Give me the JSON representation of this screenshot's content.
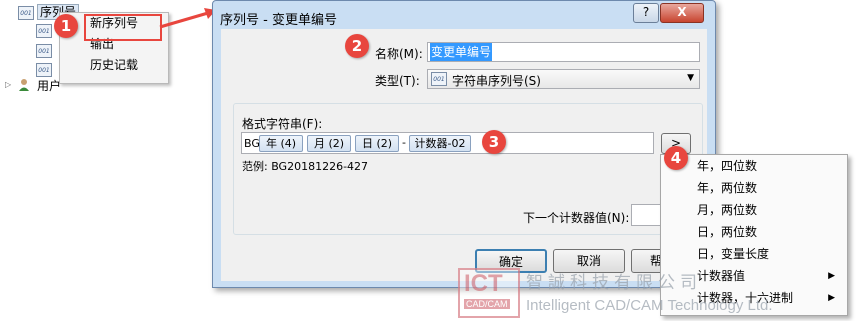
{
  "tree": {
    "items": [
      {
        "icon_text": "001",
        "label": "序列号"
      },
      {
        "icon_text": "001"
      },
      {
        "icon_text": "001"
      },
      {
        "icon_text": "001"
      },
      {
        "label": "用户"
      }
    ]
  },
  "context_menu": {
    "items": [
      "新序列号",
      "输出",
      "历史记载"
    ]
  },
  "callouts": [
    "1",
    "2",
    "3",
    "4"
  ],
  "dialog": {
    "title": "序列号 - 变更单编号",
    "help_button": "?",
    "close_button": "X",
    "name_label": "名称(M):",
    "name_value": "变更单编号",
    "type_label": "类型(T):",
    "type_value": "字符串序列号(S)",
    "format_label": "格式字符串(F):",
    "format_prefix": "BG",
    "format_tokens": [
      "年 (4)",
      "月 (2)",
      "日 (2)",
      "计数器-02"
    ],
    "format_separators": [
      "",
      "",
      "-"
    ],
    "insert_button": ">",
    "example_label": "范例: BG20181226-427",
    "next_counter_label": "下一个计数器值(N):",
    "ok": "确定",
    "cancel": "取消",
    "help": "帮"
  },
  "insert_menu": {
    "items": [
      {
        "label": "年，四位数",
        "submenu": false
      },
      {
        "label": "年，两位数",
        "submenu": false
      },
      {
        "label": "月，两位数",
        "submenu": false
      },
      {
        "label": "日，两位数",
        "submenu": false
      },
      {
        "label": "日，变量长度",
        "submenu": false
      },
      {
        "label": "计数器值",
        "submenu": true
      },
      {
        "label": "计数器，十六进制",
        "submenu": true
      }
    ]
  },
  "watermark": {
    "logo_top": "ICT",
    "logo_sub": "CAD/CAM",
    "company_cn": "智誠科技有限公司",
    "company_en": "Intelligent CAD/CAM Technology Ltd."
  },
  "colors": {
    "accent_red": "#e8463e",
    "dialog_frame": "#c9def3",
    "selection_blue": "#3399ff"
  }
}
